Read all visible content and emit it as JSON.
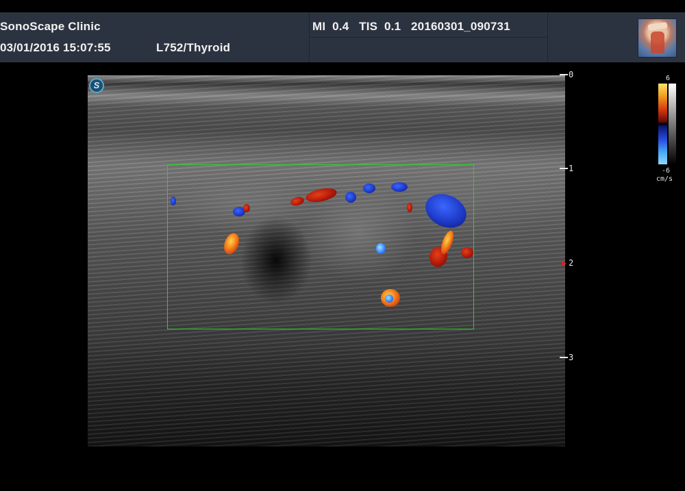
{
  "header": {
    "clinic": "SonoScape Clinic",
    "datetime": "03/01/2016 15:07:55",
    "probe_preset": "L752/Thyroid",
    "acoustic": "MI  0.4   TIS  0.1   20160301_090731"
  },
  "logo": {
    "letter": "S"
  },
  "depth_scale": {
    "labels": [
      "0",
      "1",
      "2",
      "3"
    ]
  },
  "color_scale": {
    "max": "6",
    "min": "-6",
    "unit": "cm/s"
  },
  "colors": {
    "roi_box": "#2bd12b",
    "header_bg": "#2c3340"
  }
}
